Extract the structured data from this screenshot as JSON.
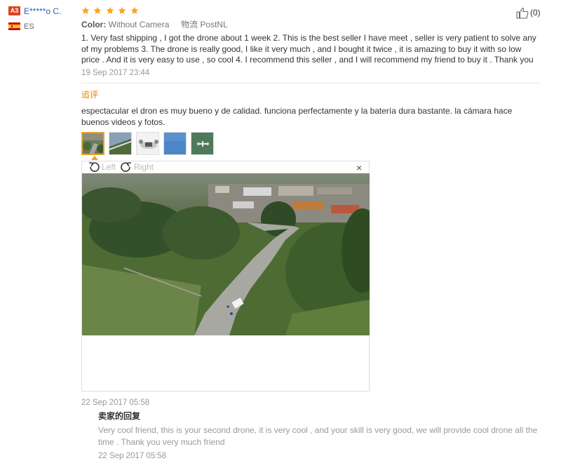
{
  "reviewer": {
    "badge": "A3",
    "name": "E*****o C.",
    "country": "ES"
  },
  "rating": {
    "stars": 5,
    "max": 5
  },
  "helpful": {
    "count": "(0)"
  },
  "meta": {
    "color_label": "Color:",
    "color_value": "Without Camera",
    "shipping_label": "物流",
    "shipping_value": "PostNL"
  },
  "review": {
    "text": "1. Very fast shipping , I got the drone about 1 week 2. This is the best seller I have meet , seller is very patient to solve any of my problems 3. The drone is really good, I like it very much , and I bought it twice , it is amazing to buy it with so low price . And it is very easy to use , so cool 4. I recommend this seller , and I will recommend my friend to buy it . Thank you",
    "date": "19 Sep 2017 23:44"
  },
  "followup": {
    "label": "追评",
    "text": "espectacular el dron es muy bueno y de calidad. funciona perfectamente y la batería dura bastante. la cámara hace buenos videos y fotos.",
    "date": "22 Sep 2017 05:58"
  },
  "viewer": {
    "rotate_left": "Left",
    "rotate_right": "Right",
    "close": "×"
  },
  "seller_reply": {
    "label": "卖家的回复",
    "text": "Very cool friend, this is your second drone, it is very cool , and your skill is very good, we will provide cool drone all the time . Thank you very much friend",
    "date": "22 Sep 2017 05:58"
  },
  "colors": {
    "badge": "#e0401e",
    "username": "#2a5fb3",
    "stars": "#f6a623",
    "followup_label": "#f08000",
    "thumb_active": "#e5a332"
  }
}
